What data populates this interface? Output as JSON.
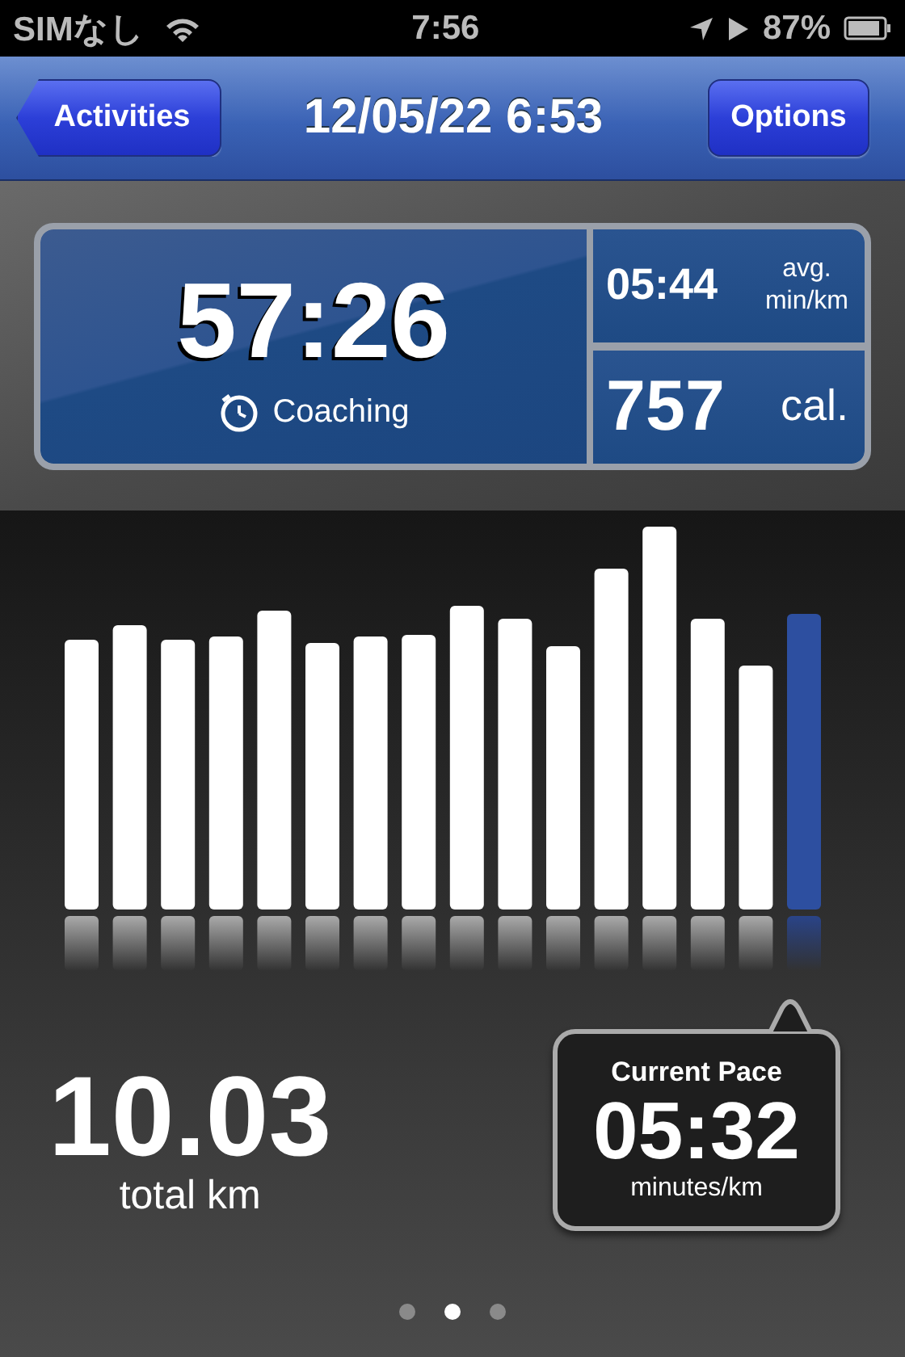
{
  "status_bar": {
    "carrier": "SIMなし",
    "time": "7:56",
    "battery": "87%"
  },
  "nav_bar": {
    "back_button": "Activities",
    "title": "12/05/22 6:53",
    "options_button": "Options"
  },
  "stats": {
    "duration": "57:26",
    "coaching": "Coaching",
    "avg_pace": "05:44",
    "avg_label": "avg.",
    "avg_unit": "min/km",
    "calories": "757",
    "calories_unit": "cal."
  },
  "distance": {
    "value": "10.03",
    "unit": "total km"
  },
  "current_pace": {
    "title": "Current Pace",
    "value": "05:32",
    "unit": "minutes/km"
  },
  "page_dots": [
    {
      "selected": false
    },
    {
      "selected": true
    },
    {
      "selected": false
    }
  ]
}
